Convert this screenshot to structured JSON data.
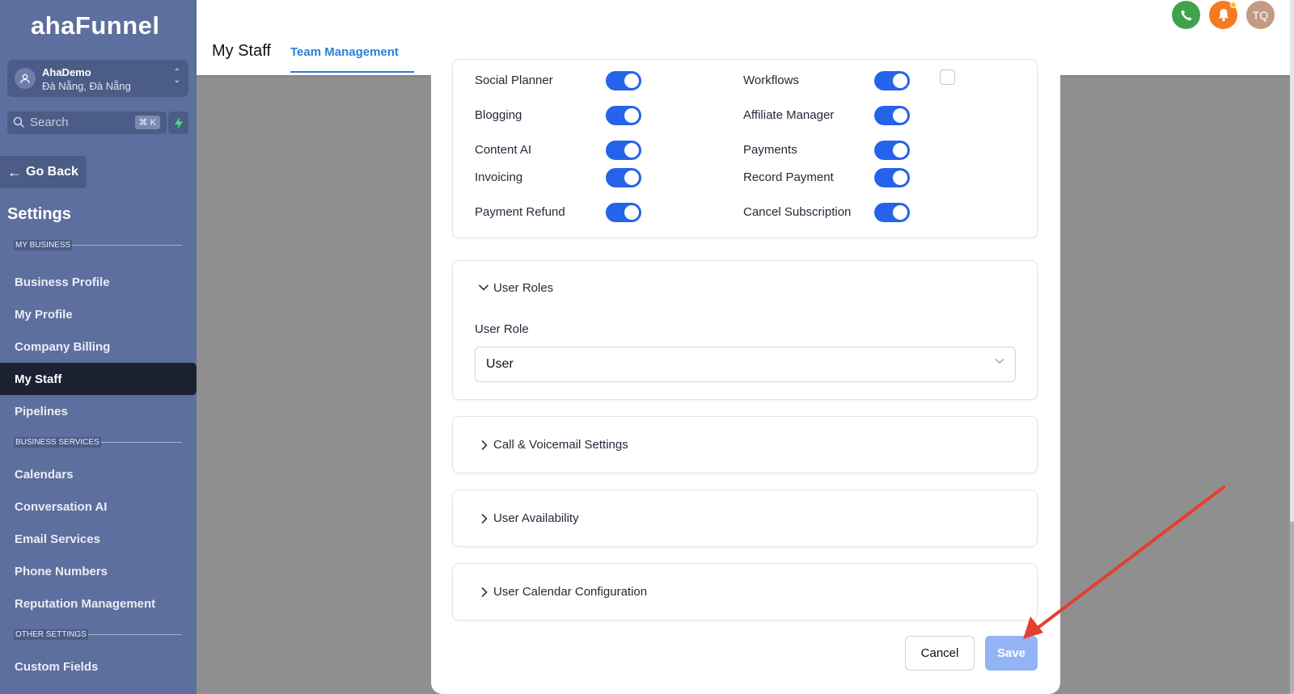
{
  "brand": {
    "logo_text": "ahaFunnel"
  },
  "account": {
    "name": "AhaDemo",
    "location": "Đà Nẵng, Đà Nẵng"
  },
  "search": {
    "placeholder": "Search",
    "shortcut": "⌘ K"
  },
  "sidebar": {
    "go_back": "Go Back",
    "title": "Settings",
    "sections": {
      "my_business": "MY BUSINESS",
      "business_services": "BUSINESS SERVICES",
      "other_settings": "OTHER SETTINGS"
    },
    "items": [
      "Business Profile",
      "My Profile",
      "Company Billing",
      "My Staff",
      "Pipelines",
      "Calendars",
      "Conversation AI",
      "Email Services",
      "Phone Numbers",
      "Reputation Management",
      "Custom Fields"
    ],
    "active_item": "My Staff"
  },
  "header": {
    "page_title": "My Staff",
    "tab": "Team Management",
    "avatar_initials": "TQ"
  },
  "permissions": {
    "left": [
      "Social Planner",
      "Blogging",
      "Content AI",
      "Invoicing",
      "Payment Refund"
    ],
    "right": [
      "Workflows",
      "Affiliate Manager",
      "Payments",
      "Record Payment",
      "Cancel Subscription"
    ],
    "all_enabled": true
  },
  "user_roles": {
    "section_title": "User Roles",
    "field_label": "User Role",
    "selected": "User"
  },
  "accordions": [
    "Call & Voicemail Settings",
    "User Availability",
    "User Calendar Configuration"
  ],
  "actions": {
    "cancel": "Cancel",
    "save": "Save"
  },
  "colors": {
    "sidebar": "#5c6f9e",
    "active_nav": "#1d2233",
    "toggle_on": "#2563eb",
    "save_disabled": "#93b4f5",
    "tab_accent": "#2b7fd9",
    "annotation": "#e53e2e"
  }
}
